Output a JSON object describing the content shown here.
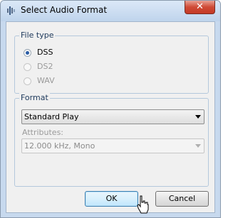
{
  "window": {
    "title": "Select Audio Format",
    "close_label": "✕"
  },
  "file_type": {
    "legend": "File type",
    "options": [
      {
        "label": "DSS",
        "checked": true,
        "enabled": true
      },
      {
        "label": "DS2",
        "checked": false,
        "enabled": false
      },
      {
        "label": "WAV",
        "checked": false,
        "enabled": false
      }
    ]
  },
  "format": {
    "legend": "Format",
    "selected": "Standard Play",
    "attributes_label": "Attributes:",
    "attributes_value": "12.000 kHz, Mono"
  },
  "buttons": {
    "ok": "OK",
    "cancel": "Cancel"
  },
  "icons": {
    "title": "audio-icon",
    "cursor": "hand-cursor-icon"
  }
}
